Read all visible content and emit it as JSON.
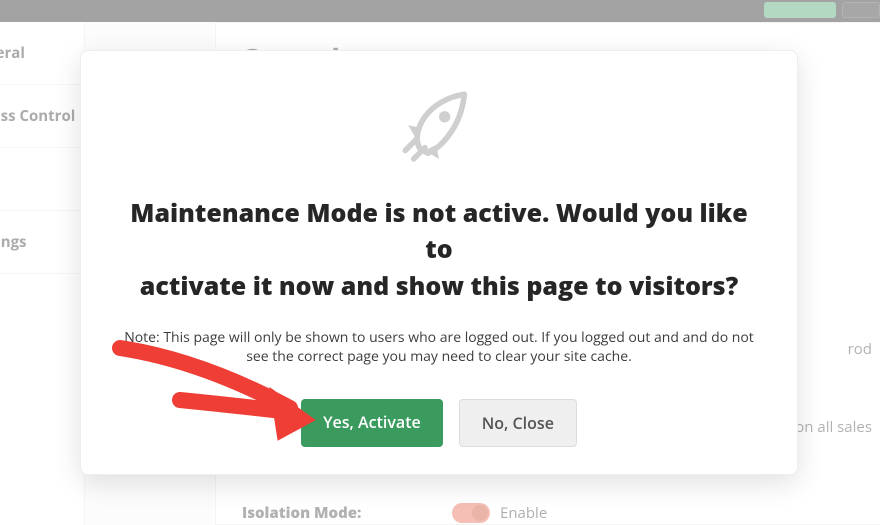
{
  "sidebar": {
    "items": [
      {
        "label": "General"
      },
      {
        "label": "Access Control"
      },
      {
        "label": ""
      },
      {
        "label": "Settings"
      }
    ]
  },
  "page": {
    "title": "General",
    "isolation_label": "Isolation Mode:",
    "enable_text": "Enable",
    "peek_text_top": "rod",
    "peek_text_mid": "on all sales"
  },
  "modal": {
    "heading_line1": "Maintenance Mode is not active. Would you like to",
    "heading_line2": "activate it now and show this page to visitors?",
    "note": "Note: This page will only be shown to users who are logged out. If you logged out and and do not see the correct page you may need to clear your site cache.",
    "yes": "Yes, Activate",
    "no": "No, Close"
  }
}
